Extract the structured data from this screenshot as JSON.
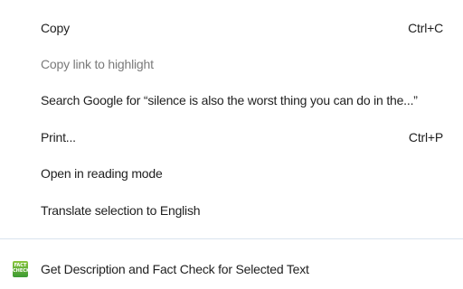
{
  "context_menu": {
    "items": [
      {
        "label": "Copy",
        "shortcut": "Ctrl+C",
        "enabled": true
      },
      {
        "label": "Copy link to highlight",
        "shortcut": "",
        "enabled": false
      },
      {
        "label": "Search Google for “silence is also the worst thing you can do in the...”",
        "shortcut": "",
        "enabled": true
      },
      {
        "label": "Print...",
        "shortcut": "Ctrl+P",
        "enabled": true
      },
      {
        "label": "Open in reading mode",
        "shortcut": "",
        "enabled": true
      },
      {
        "label": "Translate selection to English",
        "shortcut": "",
        "enabled": true
      }
    ],
    "extension_item": {
      "label": "Get Description and Fact Check for Selected Text",
      "icon": "fact-check-icon",
      "icon_text_1": "FACT",
      "icon_text_2": "CHECK"
    },
    "colors": {
      "text": "#1f1f1f",
      "disabled_text": "#7a7a7a",
      "divider": "#d9e3ee",
      "icon_green": "#3c9a33"
    }
  }
}
